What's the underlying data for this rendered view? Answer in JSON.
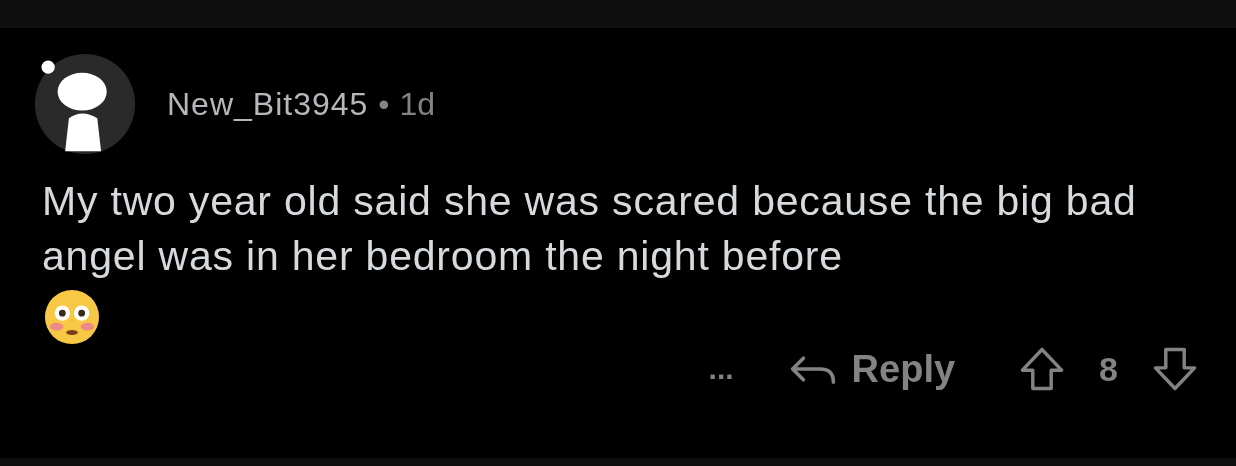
{
  "comment": {
    "author": "New_Bit3945",
    "separator": "•",
    "age": "1d",
    "body": "My two year old said she was scared because the big bad angel was in her bedroom the night before"
  },
  "actions": {
    "more": "...",
    "reply": "Reply",
    "score": "8"
  }
}
